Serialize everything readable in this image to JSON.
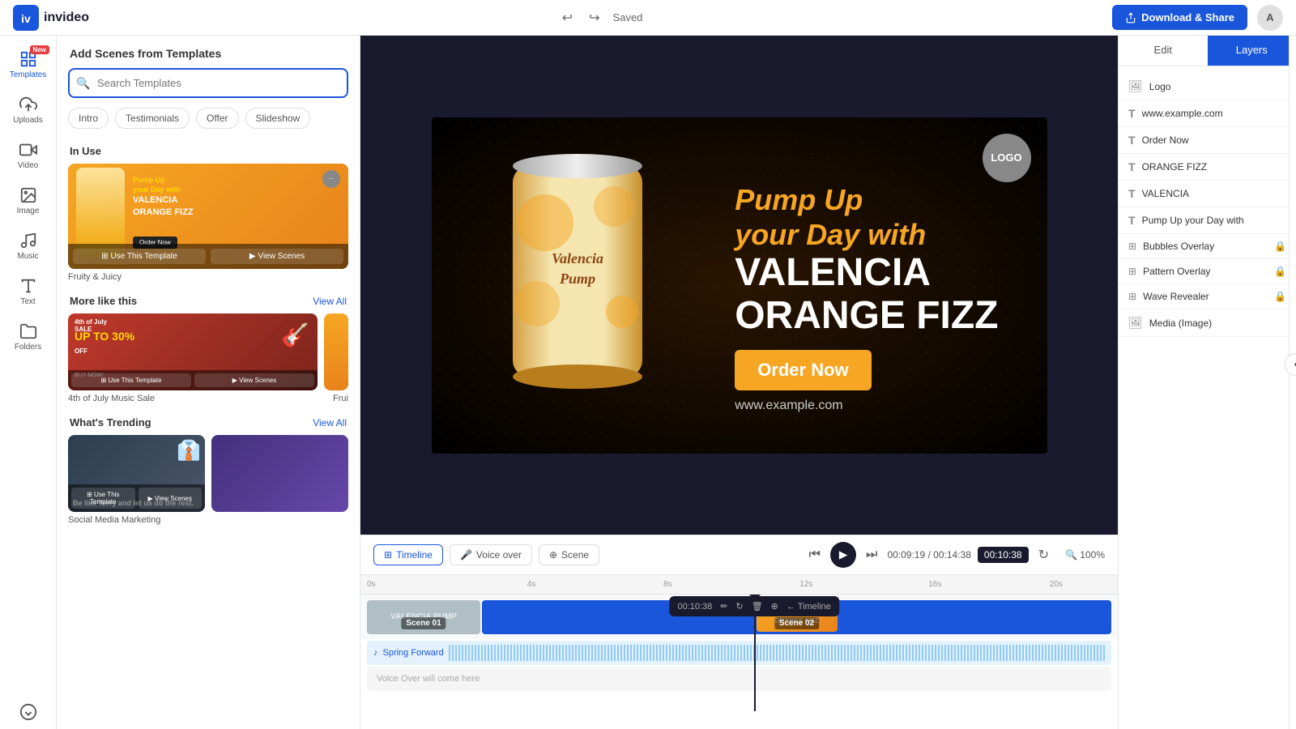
{
  "brand": {
    "name": "invideo",
    "logo_text": "iv"
  },
  "topbar": {
    "saved_label": "Saved",
    "download_label": "Download & Share",
    "undo_icon": "↩",
    "redo_icon": "↪"
  },
  "left_nav": {
    "items": [
      {
        "id": "templates",
        "label": "Templates",
        "icon": "grid",
        "active": true,
        "new": true
      },
      {
        "id": "uploads",
        "label": "Uploads",
        "icon": "upload",
        "active": false
      },
      {
        "id": "video",
        "label": "Video",
        "icon": "video",
        "active": false
      },
      {
        "id": "image",
        "label": "Image",
        "icon": "image",
        "active": false
      },
      {
        "id": "music",
        "label": "Music",
        "icon": "music",
        "active": false
      },
      {
        "id": "text",
        "label": "Text",
        "icon": "text",
        "active": false
      },
      {
        "id": "folders",
        "label": "Folders",
        "icon": "folder",
        "active": false
      }
    ]
  },
  "sidebar": {
    "header": "Add Scenes from Templates",
    "search_placeholder": "Search Templates",
    "filters": [
      "Intro",
      "Testimonials",
      "Offer",
      "Slideshow"
    ],
    "in_use_label": "In Use",
    "template_name": "Fruity & Juicy",
    "use_template_btn": "Use This Template",
    "view_scenes_btn": "View Scenes",
    "more_like_this_label": "More like this",
    "view_all_label": "View All",
    "more_template_1": "4th of July Music Sale",
    "more_template_2": "Frui",
    "trending_label": "What's Trending",
    "trending_template": "Be like Terry and let us do the rest.",
    "social_media_label": "Social Media Marketing"
  },
  "preview": {
    "pump_text": "Pump Up your Day with",
    "brand_line1": "VALENCIA",
    "brand_line2": "ORANGE FIZZ",
    "order_btn": "Order Now",
    "website": "www.example.com",
    "logo_badge": "LOGO"
  },
  "timeline": {
    "tabs": [
      "Timeline",
      "Voice over",
      "Scene"
    ],
    "time_current": "00:09:19",
    "time_total": "00:14:38",
    "time_edit": "00:10:38",
    "zoom": "100%",
    "popup_time": "00:10:38",
    "popup_actions": [
      "✏",
      "↻",
      "🗑",
      "⊕",
      "← Timeline"
    ],
    "scene1_label": "Scene 01",
    "scene2_label": "Scene 02",
    "audio_label": "Spring Forward",
    "voiceover_label": "Voice Over will come here",
    "ruler_marks": [
      "0s",
      "4s",
      "8s",
      "12s",
      "16s",
      "20s"
    ]
  },
  "right_panel": {
    "tab_edit": "Edit",
    "tab_layers": "Layers",
    "layers": [
      {
        "id": "logo",
        "name": "Logo",
        "type": "image",
        "locked": false
      },
      {
        "id": "website",
        "name": "www.example.com",
        "type": "text",
        "locked": false
      },
      {
        "id": "order",
        "name": "Order Now",
        "type": "text",
        "locked": false
      },
      {
        "id": "orange-fizz",
        "name": "ORANGE FIZZ",
        "type": "text",
        "locked": false
      },
      {
        "id": "valencia",
        "name": "VALENCIA",
        "type": "text",
        "locked": false
      },
      {
        "id": "pump",
        "name": "Pump Up your Day with",
        "type": "text",
        "locked": false
      },
      {
        "id": "bubbles-overlay",
        "name": "Bubbles Overlay",
        "type": "overlay",
        "locked": true
      },
      {
        "id": "pattern-overlay",
        "name": "Pattern Overlay",
        "type": "overlay",
        "locked": true
      },
      {
        "id": "wave-revealer",
        "name": "Wave Revealer",
        "type": "overlay",
        "locked": true
      },
      {
        "id": "media-image",
        "name": "Media (Image)",
        "type": "image",
        "locked": false
      }
    ]
  }
}
